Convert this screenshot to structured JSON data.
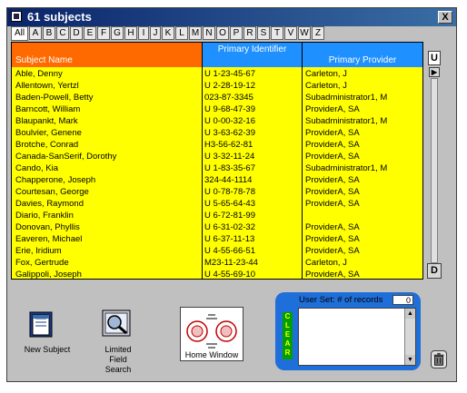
{
  "window": {
    "title": "61 subjects",
    "close_label": "X"
  },
  "tabs": [
    "All",
    "A",
    "B",
    "C",
    "D",
    "E",
    "F",
    "G",
    "H",
    "I",
    "J",
    "K",
    "L",
    "M",
    "N",
    "O",
    "P",
    "R",
    "S",
    "T",
    "V",
    "W",
    "Z"
  ],
  "active_tab": "All",
  "columns": {
    "name": "Subject Name",
    "identifier": "Primary Identifier",
    "provider": "Primary Provider"
  },
  "rows": [
    {
      "name": "Able, Denny",
      "id": "U 1-23-45-67",
      "provider": "Carleton, J"
    },
    {
      "name": "Allentown, Yertzl",
      "id": "U 2-28-19-12",
      "provider": "Carleton, J"
    },
    {
      "name": "Baden-Powell, Betty",
      "id": "023-87-3345",
      "provider": "Subadministrator1, M"
    },
    {
      "name": "Barncott, William",
      "id": "U 9-68-47-39",
      "provider": "ProviderA, SA"
    },
    {
      "name": "Blaupankt, Mark",
      "id": "U 0-00-32-16",
      "provider": "Subadministrator1, M"
    },
    {
      "name": "Boulvier, Genene",
      "id": "U 3-63-62-39",
      "provider": "ProviderA, SA"
    },
    {
      "name": "Brotche, Conrad",
      "id": "H3-56-62-81",
      "provider": "ProviderA, SA"
    },
    {
      "name": "Canada-SanSerif, Dorothy",
      "id": "U 3-32-11-24",
      "provider": "ProviderA, SA"
    },
    {
      "name": "Cando, Kia",
      "id": "U 1-83-35-67",
      "provider": "Subadministrator1, M"
    },
    {
      "name": "Chapperone, Joseph",
      "id": "324-44-1114",
      "provider": "ProviderA, SA"
    },
    {
      "name": "Courtesan, George",
      "id": "U 0-78-78-78",
      "provider": "ProviderA, SA"
    },
    {
      "name": "Davies, Raymond",
      "id": "U 5-65-64-43",
      "provider": "ProviderA, SA"
    },
    {
      "name": "Diario, Franklin",
      "id": "U 6-72-81-99",
      "provider": ""
    },
    {
      "name": "Donovan, Phyllis",
      "id": "U 6-31-02-32",
      "provider": "ProviderA, SA"
    },
    {
      "name": "Eaveren, Michael",
      "id": "U 6-37-11-13",
      "provider": "ProviderA, SA"
    },
    {
      "name": "Erie, Iridium",
      "id": "U 4-55-66-51",
      "provider": "ProviderA, SA"
    },
    {
      "name": "Fox, Gertrude",
      "id": "M23-11-23-44",
      "provider": "Carleton, J"
    },
    {
      "name": "Galippoli, Joseph",
      "id": "U 4-55-69-10",
      "provider": "ProviderA, SA"
    }
  ],
  "side_controls": {
    "up_label": "U",
    "right_arrow": "▶",
    "down_label": "D"
  },
  "buttons": {
    "new_subject": "New Subject",
    "limited_field_search": "Limited Field Search",
    "home_window": "Home Window"
  },
  "user_set": {
    "label": "User Set:  # of records",
    "count": "0",
    "clear_label": "CLEAR"
  },
  "icons": {
    "app": "app-icon",
    "close": "close-icon",
    "new_subject": "note-icon",
    "search": "magnifier-icon",
    "trash": "trash-icon"
  },
  "colors": {
    "grid_bg": "#ffff00",
    "name_header": "#ff6a00",
    "id_header": "#1e90ff",
    "user_set_bg": "#1e6fd9",
    "clear_bg": "#00a000"
  }
}
